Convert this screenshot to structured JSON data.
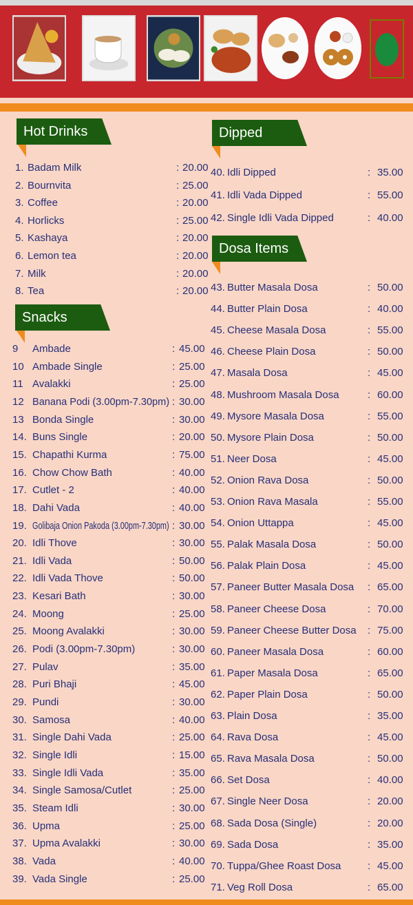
{
  "sections": {
    "hot_drinks": {
      "title": "Hot Drinks",
      "items": [
        {
          "num": "1.",
          "name": "Badam Milk",
          "price": "20.00"
        },
        {
          "num": "2.",
          "name": "Bournvita",
          "price": "25.00"
        },
        {
          "num": "3.",
          "name": "Coffee",
          "price": "20.00"
        },
        {
          "num": "4.",
          "name": "Horlicks",
          "price": "25.00"
        },
        {
          "num": "5.",
          "name": "Kashaya",
          "price": "20.00"
        },
        {
          "num": "6.",
          "name": "Lemon tea",
          "price": "20.00"
        },
        {
          "num": "7.",
          "name": "Milk",
          "price": "20.00"
        },
        {
          "num": "8.",
          "name": "Tea",
          "price": "20.00"
        }
      ]
    },
    "snacks": {
      "title": "Snacks",
      "items": [
        {
          "num": "9",
          "name": "Ambade",
          "price": "45.00"
        },
        {
          "num": "10",
          "name": "Ambade Single",
          "price": "25.00"
        },
        {
          "num": "11",
          "name": "Avalakki",
          "price": "25.00"
        },
        {
          "num": "12",
          "name": "Banana Podi (3.00pm-7.30pm)",
          "price": "30.00"
        },
        {
          "num": "13",
          "name": "Bonda Single",
          "price": "30.00"
        },
        {
          "num": "14.",
          "name": "Buns Single",
          "price": "20.00"
        },
        {
          "num": "15.",
          "name": "Chapathi Kurma",
          "price": "75.00"
        },
        {
          "num": "16.",
          "name": "Chow Chow Bath",
          "price": "40.00"
        },
        {
          "num": "17.",
          "name": "Cutlet - 2",
          "price": "40.00"
        },
        {
          "num": "18.",
          "name": "Dahi Vada",
          "price": "40.00"
        },
        {
          "num": "19.",
          "name": "Golibaja Onion Pakoda (3.00pm-7.30pm)",
          "price": "30.00"
        },
        {
          "num": "20.",
          "name": "Idli Thove",
          "price": "30.00"
        },
        {
          "num": "21.",
          "name": "Idli Vada",
          "price": "50.00"
        },
        {
          "num": "22.",
          "name": "Idli Vada Thove",
          "price": "50.00"
        },
        {
          "num": "23.",
          "name": "Kesari Bath",
          "price": "30.00"
        },
        {
          "num": "24.",
          "name": "Moong",
          "price": "25.00"
        },
        {
          "num": "25.",
          "name": "Moong Avalakki",
          "price": "30.00"
        },
        {
          "num": "26.",
          "name": "Podi (3.00pm-7.30pm)",
          "price": "30.00"
        },
        {
          "num": "27.",
          "name": "Pulav",
          "price": "35.00"
        },
        {
          "num": "28.",
          "name": "Puri Bhaji",
          "price": "45.00"
        },
        {
          "num": "29.",
          "name": "Pundi",
          "price": "30.00"
        },
        {
          "num": "30.",
          "name": "Samosa",
          "price": "40.00"
        },
        {
          "num": "31.",
          "name": "Single Dahi Vada",
          "price": "25.00"
        },
        {
          "num": "32.",
          "name": "Single Idli",
          "price": "15.00"
        },
        {
          "num": "33.",
          "name": "Single Idli Vada",
          "price": "35.00"
        },
        {
          "num": "34.",
          "name": "Single Samosa/Cutlet",
          "price": "25.00"
        },
        {
          "num": "35.",
          "name": "Steam Idli",
          "price": "30.00"
        },
        {
          "num": "36.",
          "name": "Upma",
          "price": "25.00"
        },
        {
          "num": "37.",
          "name": "Upma Avalakki",
          "price": "30.00"
        },
        {
          "num": "38.",
          "name": "Vada",
          "price": "40.00"
        },
        {
          "num": "39.",
          "name": "Vada Single",
          "price": "25.00"
        }
      ]
    },
    "dipped": {
      "title": "Dipped",
      "items": [
        {
          "num": "40.",
          "name": "Idli Dipped",
          "price": "35.00"
        },
        {
          "num": "41.",
          "name": "Idli Vada Dipped",
          "price": "55.00"
        },
        {
          "num": "42.",
          "name": "Single Idli Vada Dipped",
          "price": "40.00"
        }
      ]
    },
    "dosa_items": {
      "title": "Dosa Items",
      "items": [
        {
          "num": "43.",
          "name": "Butter Masala Dosa",
          "price": "50.00"
        },
        {
          "num": "44.",
          "name": "Butter Plain Dosa",
          "price": "40.00"
        },
        {
          "num": "45.",
          "name": "Cheese Masala Dosa",
          "price": "55.00"
        },
        {
          "num": "46.",
          "name": "Cheese Plain Dosa",
          "price": "50.00"
        },
        {
          "num": "47.",
          "name": "Masala Dosa",
          "price": "45.00"
        },
        {
          "num": "48.",
          "name": "Mushroom Masala Dosa",
          "price": "60.00"
        },
        {
          "num": "49.",
          "name": "Mysore Masala Dosa",
          "price": "55.00"
        },
        {
          "num": "50.",
          "name": "Mysore Plain Dosa",
          "price": "50.00"
        },
        {
          "num": "51.",
          "name": "Neer Dosa",
          "price": "45.00"
        },
        {
          "num": "52.",
          "name": "Onion Rava Dosa",
          "price": "50.00"
        },
        {
          "num": "53.",
          "name": "Onion Rava Masala",
          "price": "55.00"
        },
        {
          "num": "54.",
          "name": "Onion Uttappa",
          "price": "45.00"
        },
        {
          "num": "55.",
          "name": "Palak Masala Dosa",
          "price": "50.00"
        },
        {
          "num": "56.",
          "name": "Palak Plain Dosa",
          "price": "45.00"
        },
        {
          "num": "57.",
          "name": "Paneer Butter Masala Dosa",
          "price": "65.00"
        },
        {
          "num": "58.",
          "name": "Paneer Cheese Dosa",
          "price": "70.00"
        },
        {
          "num": "59.",
          "name": "Paneer Cheese Butter Dosa",
          "price": "75.00"
        },
        {
          "num": "60.",
          "name": "Paneer Masala Dosa",
          "price": "60.00"
        },
        {
          "num": "61.",
          "name": "Paper Masala Dosa",
          "price": "65.00"
        },
        {
          "num": "62.",
          "name": "Paper Plain Dosa",
          "price": "50.00"
        },
        {
          "num": "63.",
          "name": "Plain Dosa",
          "price": "35.00"
        },
        {
          "num": "64.",
          "name": "Rava Dosa",
          "price": "45.00"
        },
        {
          "num": "65.",
          "name": "Rava Masala Dosa",
          "price": "50.00"
        },
        {
          "num": "66.",
          "name": "Set Dosa",
          "price": "40.00"
        },
        {
          "num": "67.",
          "name": "Single Neer Dosa",
          "price": "20.00"
        },
        {
          "num": "68.",
          "name": "Sada Dosa (Single)",
          "price": "20.00"
        },
        {
          "num": "69.",
          "name": "Sada Dosa",
          "price": "35.00"
        },
        {
          "num": "70.",
          "name": "Tuppa/Ghee Roast Dosa",
          "price": "45.00"
        },
        {
          "num": "71.",
          "name": "Veg Roll Dosa",
          "price": "65.00"
        }
      ]
    }
  },
  "separator": ":",
  "colors": {
    "banner": "#c8262d",
    "accent": "#f08c1e",
    "tag": "#1c5c10",
    "text": "#27307a",
    "background": "#f9d6c6"
  },
  "banner_images": [
    "dosa-image",
    "tea-cup-image",
    "idli-image",
    "pav-bhaji-image",
    "thali-image",
    "vada-image"
  ]
}
